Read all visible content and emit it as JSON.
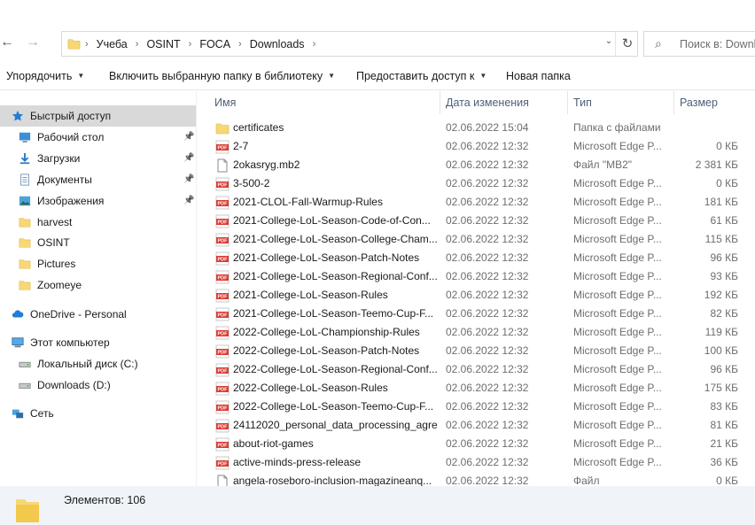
{
  "breadcrumbs": [
    "Учеба",
    "OSINT",
    "FOCA",
    "Downloads"
  ],
  "search": {
    "placeholder": "Поиск в: Downloads"
  },
  "toolbar": {
    "organize": "Упорядочить",
    "include_library": "Включить выбранную папку в библиотеку",
    "share": "Предоставить доступ к",
    "new_folder": "Новая папка"
  },
  "nav": [
    {
      "label": "Быстрый доступ",
      "icon": "star-icon",
      "pinned": false,
      "state": "hover"
    },
    {
      "label": "Рабочий стол",
      "icon": "desktop-icon",
      "pinned": true
    },
    {
      "label": "Загрузки",
      "icon": "download-icon",
      "pinned": true
    },
    {
      "label": "Документы",
      "icon": "documents-icon",
      "pinned": true
    },
    {
      "label": "Изображения",
      "icon": "pictures-icon",
      "pinned": true
    },
    {
      "label": "harvest",
      "icon": "folder-icon",
      "pinned": false
    },
    {
      "label": "OSINT",
      "icon": "folder-icon",
      "pinned": false
    },
    {
      "label": "Pictures",
      "icon": "folder-icon",
      "pinned": false
    },
    {
      "label": "Zoomeye",
      "icon": "folder-icon",
      "pinned": false
    },
    {
      "label": "OneDrive - Personal",
      "icon": "cloud-icon",
      "pinned": false
    },
    {
      "label": "Этот компьютер",
      "icon": "computer-icon",
      "pinned": false
    },
    {
      "label": "Локальный диск (C:)",
      "icon": "drive-icon",
      "pinned": false
    },
    {
      "label": "Downloads (D:)",
      "icon": "drive-icon",
      "pinned": false
    },
    {
      "label": "Сеть",
      "icon": "network-icon",
      "pinned": false
    }
  ],
  "columns": {
    "name": "Имя",
    "date": "Дата изменения",
    "type": "Тип",
    "size": "Размер"
  },
  "files": [
    {
      "name": "certificates",
      "date": "02.06.2022 15:04",
      "type": "Папка с файлами",
      "size": "",
      "kind": "folder"
    },
    {
      "name": "2-7",
      "date": "02.06.2022 12:32",
      "type": "Microsoft Edge P...",
      "size": "0 КБ",
      "kind": "pdf"
    },
    {
      "name": "2okasryg.mb2",
      "date": "02.06.2022 12:32",
      "type": "Файл \"MB2\"",
      "size": "2 381 КБ",
      "kind": "file"
    },
    {
      "name": "3-500-2",
      "date": "02.06.2022 12:32",
      "type": "Microsoft Edge P...",
      "size": "0 КБ",
      "kind": "pdf"
    },
    {
      "name": "2021-CLOL-Fall-Warmup-Rules",
      "date": "02.06.2022 12:32",
      "type": "Microsoft Edge P...",
      "size": "181 КБ",
      "kind": "pdf"
    },
    {
      "name": "2021-College-LoL-Season-Code-of-Con...",
      "date": "02.06.2022 12:32",
      "type": "Microsoft Edge P...",
      "size": "61 КБ",
      "kind": "pdf"
    },
    {
      "name": "2021-College-LoL-Season-College-Cham...",
      "date": "02.06.2022 12:32",
      "type": "Microsoft Edge P...",
      "size": "115 КБ",
      "kind": "pdf"
    },
    {
      "name": "2021-College-LoL-Season-Patch-Notes",
      "date": "02.06.2022 12:32",
      "type": "Microsoft Edge P...",
      "size": "96 КБ",
      "kind": "pdf"
    },
    {
      "name": "2021-College-LoL-Season-Regional-Conf...",
      "date": "02.06.2022 12:32",
      "type": "Microsoft Edge P...",
      "size": "93 КБ",
      "kind": "pdf"
    },
    {
      "name": "2021-College-LoL-Season-Rules",
      "date": "02.06.2022 12:32",
      "type": "Microsoft Edge P...",
      "size": "192 КБ",
      "kind": "pdf"
    },
    {
      "name": "2021-College-LoL-Season-Teemo-Cup-F...",
      "date": "02.06.2022 12:32",
      "type": "Microsoft Edge P...",
      "size": "82 КБ",
      "kind": "pdf"
    },
    {
      "name": "2022-College-LoL-Championship-Rules",
      "date": "02.06.2022 12:32",
      "type": "Microsoft Edge P...",
      "size": "119 КБ",
      "kind": "pdf"
    },
    {
      "name": "2022-College-LoL-Season-Patch-Notes",
      "date": "02.06.2022 12:32",
      "type": "Microsoft Edge P...",
      "size": "100 КБ",
      "kind": "pdf"
    },
    {
      "name": "2022-College-LoL-Season-Regional-Conf...",
      "date": "02.06.2022 12:32",
      "type": "Microsoft Edge P...",
      "size": "96 КБ",
      "kind": "pdf"
    },
    {
      "name": "2022-College-LoL-Season-Rules",
      "date": "02.06.2022 12:32",
      "type": "Microsoft Edge P...",
      "size": "175 КБ",
      "kind": "pdf"
    },
    {
      "name": "2022-College-LoL-Season-Teemo-Cup-F...",
      "date": "02.06.2022 12:32",
      "type": "Microsoft Edge P...",
      "size": "83 КБ",
      "kind": "pdf"
    },
    {
      "name": "24112020_personal_data_processing_agre...",
      "date": "02.06.2022 12:32",
      "type": "Microsoft Edge P...",
      "size": "81 КБ",
      "kind": "pdf"
    },
    {
      "name": "about-riot-games",
      "date": "02.06.2022 12:32",
      "type": "Microsoft Edge P...",
      "size": "21 КБ",
      "kind": "pdf"
    },
    {
      "name": "active-minds-press-release",
      "date": "02.06.2022 12:32",
      "type": "Microsoft Edge P...",
      "size": "36 КБ",
      "kind": "pdf"
    },
    {
      "name": "angela-roseboro-inclusion-magazineanq...",
      "date": "02.06.2022 12:32",
      "type": "Файл",
      "size": "0 КБ",
      "kind": "file"
    }
  ],
  "status": {
    "count_text": "Элементов: 106"
  },
  "colors": {
    "selected_bg": "#cce8ff",
    "hover_bg": "#d9d9d9",
    "status_bg": "#f0f4f9",
    "folder": "#f8d775",
    "pdf_red": "#d9382f",
    "header_text": "#4c607a"
  }
}
